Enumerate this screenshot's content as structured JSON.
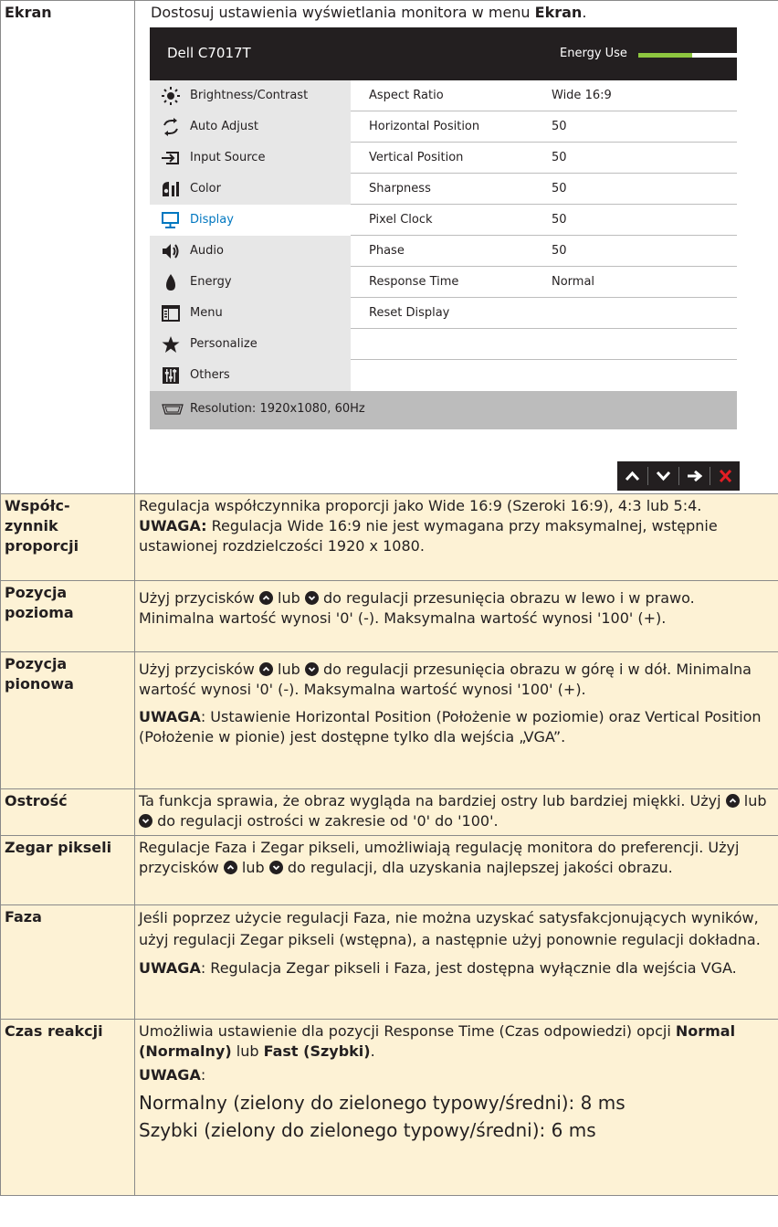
{
  "ekran": {
    "label": "Ekran",
    "intro_pre": "Dostosuj ustawienia wyświetlania monitora w menu ",
    "intro_bold": "Ekran",
    "intro_post": "."
  },
  "osd": {
    "model": "Dell C7017T",
    "energy_label": "Energy Use",
    "energy_level": 0.55,
    "menu": [
      {
        "label": "Brightness/Contrast",
        "icon": "sun-icon"
      },
      {
        "label": "Auto Adjust",
        "icon": "auto-adjust-icon"
      },
      {
        "label": "Input Source",
        "icon": "input-source-icon"
      },
      {
        "label": "Color",
        "icon": "color-icon"
      },
      {
        "label": "Display",
        "icon": "monitor-icon"
      },
      {
        "label": "Audio",
        "icon": "speaker-icon"
      },
      {
        "label": "Energy",
        "icon": "flame-icon"
      },
      {
        "label": "Menu",
        "icon": "menu-window-icon"
      },
      {
        "label": "Personalize",
        "icon": "star-icon"
      },
      {
        "label": "Others",
        "icon": "sliders-icon"
      }
    ],
    "active_index": 4,
    "settings": [
      {
        "name": "Aspect Ratio",
        "value": "Wide 16:9"
      },
      {
        "name": "Horizontal Position",
        "value": "50"
      },
      {
        "name": "Vertical Position",
        "value": "50"
      },
      {
        "name": "Sharpness",
        "value": "50"
      },
      {
        "name": "Pixel Clock",
        "value": "50"
      },
      {
        "name": "Phase",
        "value": "50"
      },
      {
        "name": "Response Time",
        "value": "Normal"
      },
      {
        "name": "Reset Display",
        "value": ""
      }
    ],
    "resolution": "Resolution: 1920x1080, 60Hz",
    "nav_icons": [
      "chevron-up-icon",
      "chevron-down-icon",
      "arrow-right-icon",
      "close-icon"
    ]
  },
  "aspect": {
    "label_lines": [
      "Współc-",
      "zynnik",
      "proporcji"
    ],
    "text": "Regulacja współczynnika proporcji jako Wide 16:9 (Szeroki 16:9), 4:3 lub 5:4.",
    "note_label": "UWAGA:",
    "note_text": " Regulacja Wide 16:9 nie jest wymagana przy maksymalnej, wstępnie ustawionej rozdzielczości 1920 x 1080."
  },
  "hpos": {
    "label_lines": [
      "Pozycja",
      "pozioma"
    ],
    "pre": "Użyj przycisków ",
    "mid": " lub ",
    "post": " do regulacji przesunięcia obrazu w lewo i w prawo. Minimalna wartość wynosi '0' (-). Maksymalna wartość wynosi '100' (+)."
  },
  "vpos": {
    "label_lines": [
      "Pozycja",
      "pionowa"
    ],
    "pre": " Użyj przycisków ",
    "mid": " lub ",
    "post": " do regulacji przesunięcia obrazu w górę i w dół. Minimalna wartość wynosi '0' (-). Maksymalna wartość wynosi '100' (+).",
    "note_label": "UWAGA",
    "note_text": ": Ustawienie Horizontal Position (Położenie w poziomie) oraz Vertical Position (Położenie w pionie) jest dostępne tylko dla wejścia „VGA”."
  },
  "sharp": {
    "label": "Ostrość",
    "pre": "Ta funkcja sprawia, że obraz wygląda na bardziej ostry lub bardziej miękki. Użyj ",
    "mid": " lub ",
    "post": " do regulacji ostrości w zakresie od '0' do '100'."
  },
  "clock": {
    "label": "Zegar pikseli",
    "pre": "Regulacje Faza i Zegar pikseli, umożliwiają regulację monitora do preferencji. Użyj przycisków ",
    "mid": " lub ",
    "post": " do regulacji, dla uzyskania najlepszej jakości obrazu."
  },
  "phase": {
    "label": "Faza",
    "text": "Jeśli poprzez użycie regulacji Faza, nie można uzyskać satysfakcjonujących wyników, użyj regulacji Zegar pikseli (wstępna), a następnie użyj ponownie regulacji dokładna.",
    "note_label": "UWAGA",
    "note_text": ": Regulacja Zegar pikseli i Faza, jest dostępna wyłącznie dla wejścia VGA."
  },
  "response": {
    "label": "Czas reakcji",
    "t1": "Umożliwia ustawienie dla pozycji Response Time (Czas odpowiedzi) opcji ",
    "b1": "Normal (Normalny)",
    "t2": " lub ",
    "b2": "Fast (Szybki)",
    "t3": ".",
    "note_label": "UWAGA",
    "note_colon": ":",
    "normal": "Normalny (zielony do zielonego typowy/średni): 8 ms",
    "fast": "Szybki (zielony do zielonego typowy/średni): 6 ms"
  }
}
